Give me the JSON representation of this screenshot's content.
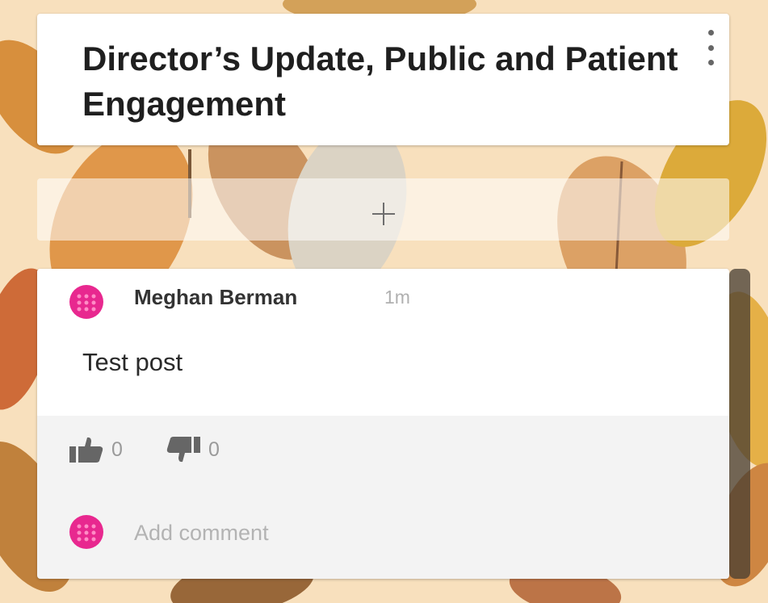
{
  "column": {
    "title": "Director’s Update, Public and Patient Engagement",
    "menu_icon": "kebab-menu-icon"
  },
  "add_post": {
    "icon": "plus-icon"
  },
  "post": {
    "author": "Meghan Berman",
    "time": "1m",
    "text": "Test post",
    "likes": "0",
    "dislikes": "0",
    "comment_placeholder": "Add comment"
  },
  "colors": {
    "background": "#f8e0bd",
    "avatar": "#e8288f",
    "card": "#ffffff",
    "card_footer": "#f3f3f3"
  }
}
